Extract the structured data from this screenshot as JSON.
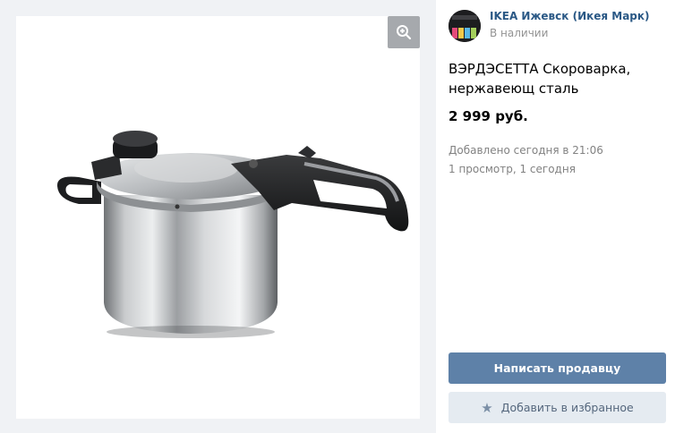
{
  "seller": {
    "name": "IKEA Ижевск (Икея Марк)",
    "status": "В наличии"
  },
  "product": {
    "title": "ВЭРДЭСЕТТА Скороварка, нержавеющ сталь",
    "price": "2 999 руб.",
    "added": "Добавлено сегодня в 21:06",
    "views": "1 просмотр, 1 сегодня"
  },
  "actions": {
    "write_seller": "Написать продавцу",
    "add_favorite": "Добавить в избранное"
  },
  "icons": {
    "zoom": "zoom-in-icon",
    "favorite": "star-icon"
  },
  "colors": {
    "primary_button": "#5e81a8",
    "secondary_button": "#e5ebf1",
    "link": "#2a5885",
    "muted_text": "#828282"
  }
}
